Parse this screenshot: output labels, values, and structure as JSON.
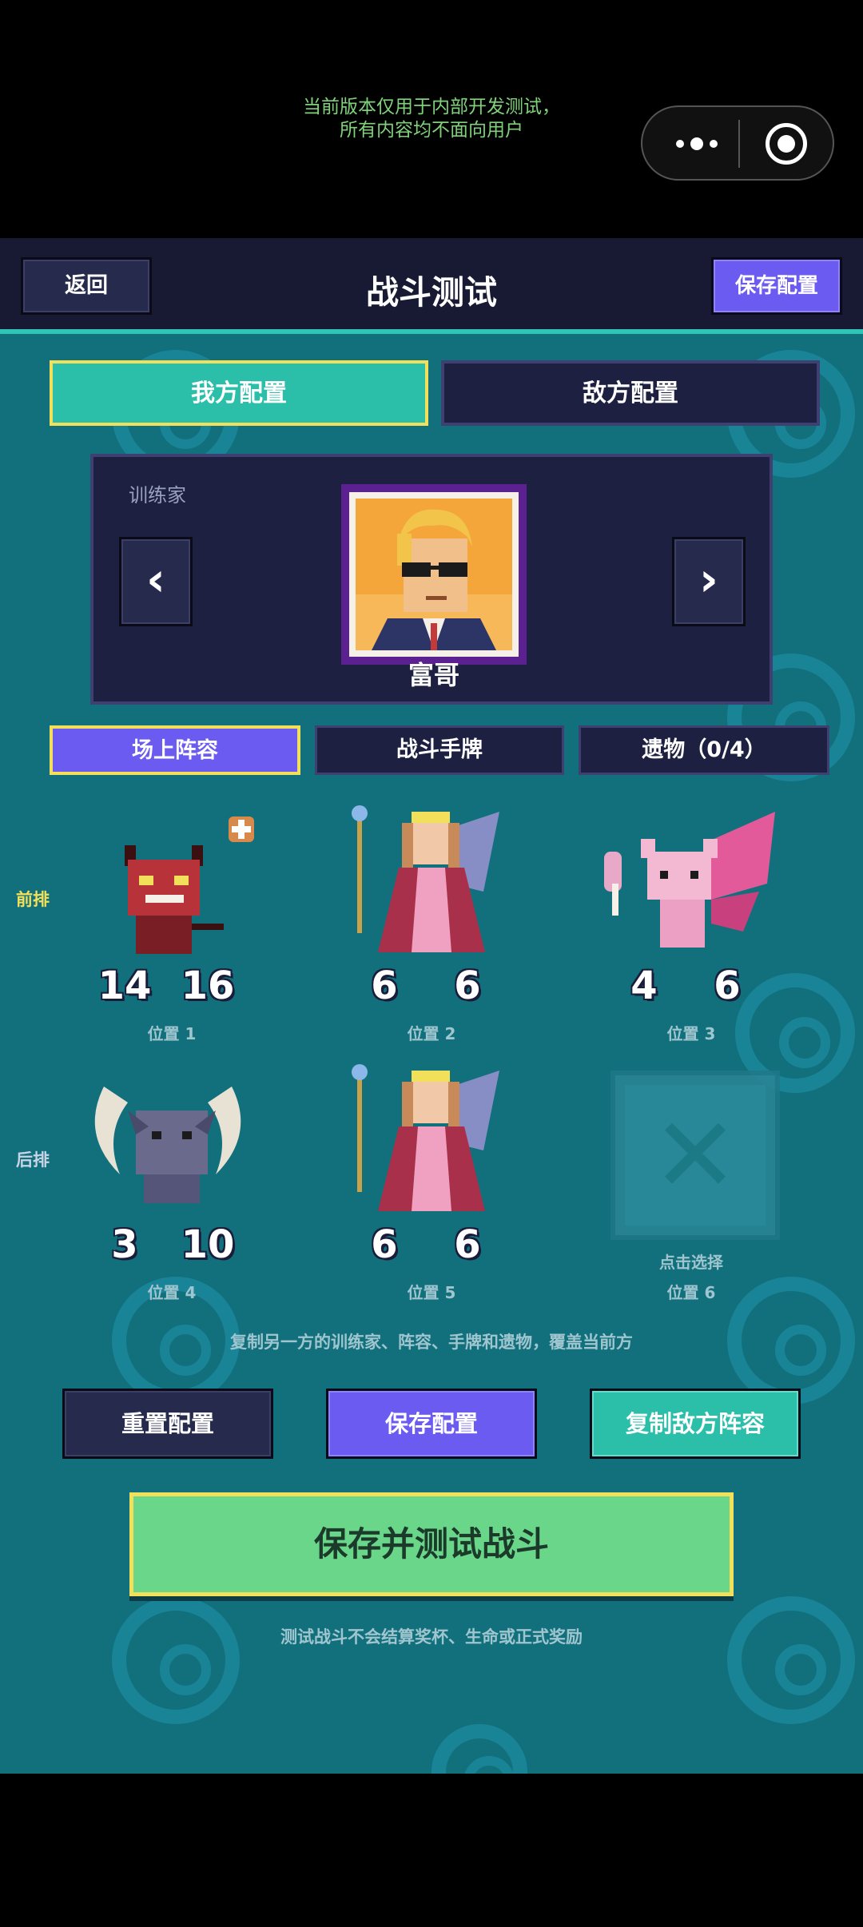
{
  "system": {
    "notice_line1": "当前版本仅用于内部开发测试，",
    "notice_line2": "所有内容均不面向用户"
  },
  "header": {
    "back_label": "返回",
    "title": "战斗测试",
    "save_label": "保存配置"
  },
  "side_tabs": {
    "mine": "我方配置",
    "enemy": "敌方配置"
  },
  "trainer": {
    "label": "训练家",
    "prev": "‹",
    "next": "›",
    "name": "富哥"
  },
  "sub_tabs": {
    "lineup": "场上阵容",
    "hand": "战斗手牌",
    "relics": "遗物（0/4）"
  },
  "rows": {
    "front": "前排",
    "back": "后排"
  },
  "slots": [
    {
      "label": "位置 1",
      "atk": "14",
      "hp": "16",
      "creature": "red-devil",
      "badge": "plus"
    },
    {
      "label": "位置 2",
      "atk": "6",
      "hp": "6",
      "creature": "fairy-queen"
    },
    {
      "label": "位置 3",
      "atk": "4",
      "hp": "6",
      "creature": "pink-butterfly"
    },
    {
      "label": "位置 4",
      "atk": "3",
      "hp": "10",
      "creature": "moon-gargoyle"
    },
    {
      "label": "位置 5",
      "atk": "6",
      "hp": "6",
      "creature": "fairy-queen"
    },
    {
      "label": "位置 6",
      "empty_text": "点击选择"
    }
  ],
  "hint": "复制另一方的训练家、阵容、手牌和遗物，覆盖当前方",
  "actions": {
    "reset": "重置配置",
    "save": "保存配置",
    "copy": "复制敌方阵容"
  },
  "primary_action": "保存并测试战斗",
  "footnote": "测试战斗不会结算奖杯、生命或正式奖励",
  "colors": {
    "background": "#11707c",
    "panel": "#1d2040",
    "accent_teal": "#2bbfaa",
    "accent_purple": "#6b5bf0",
    "highlight_yellow": "#f3e05a",
    "primary_green": "#6ad68a",
    "atk_blue": "#3d8fd8",
    "hp_red": "#d84040"
  }
}
